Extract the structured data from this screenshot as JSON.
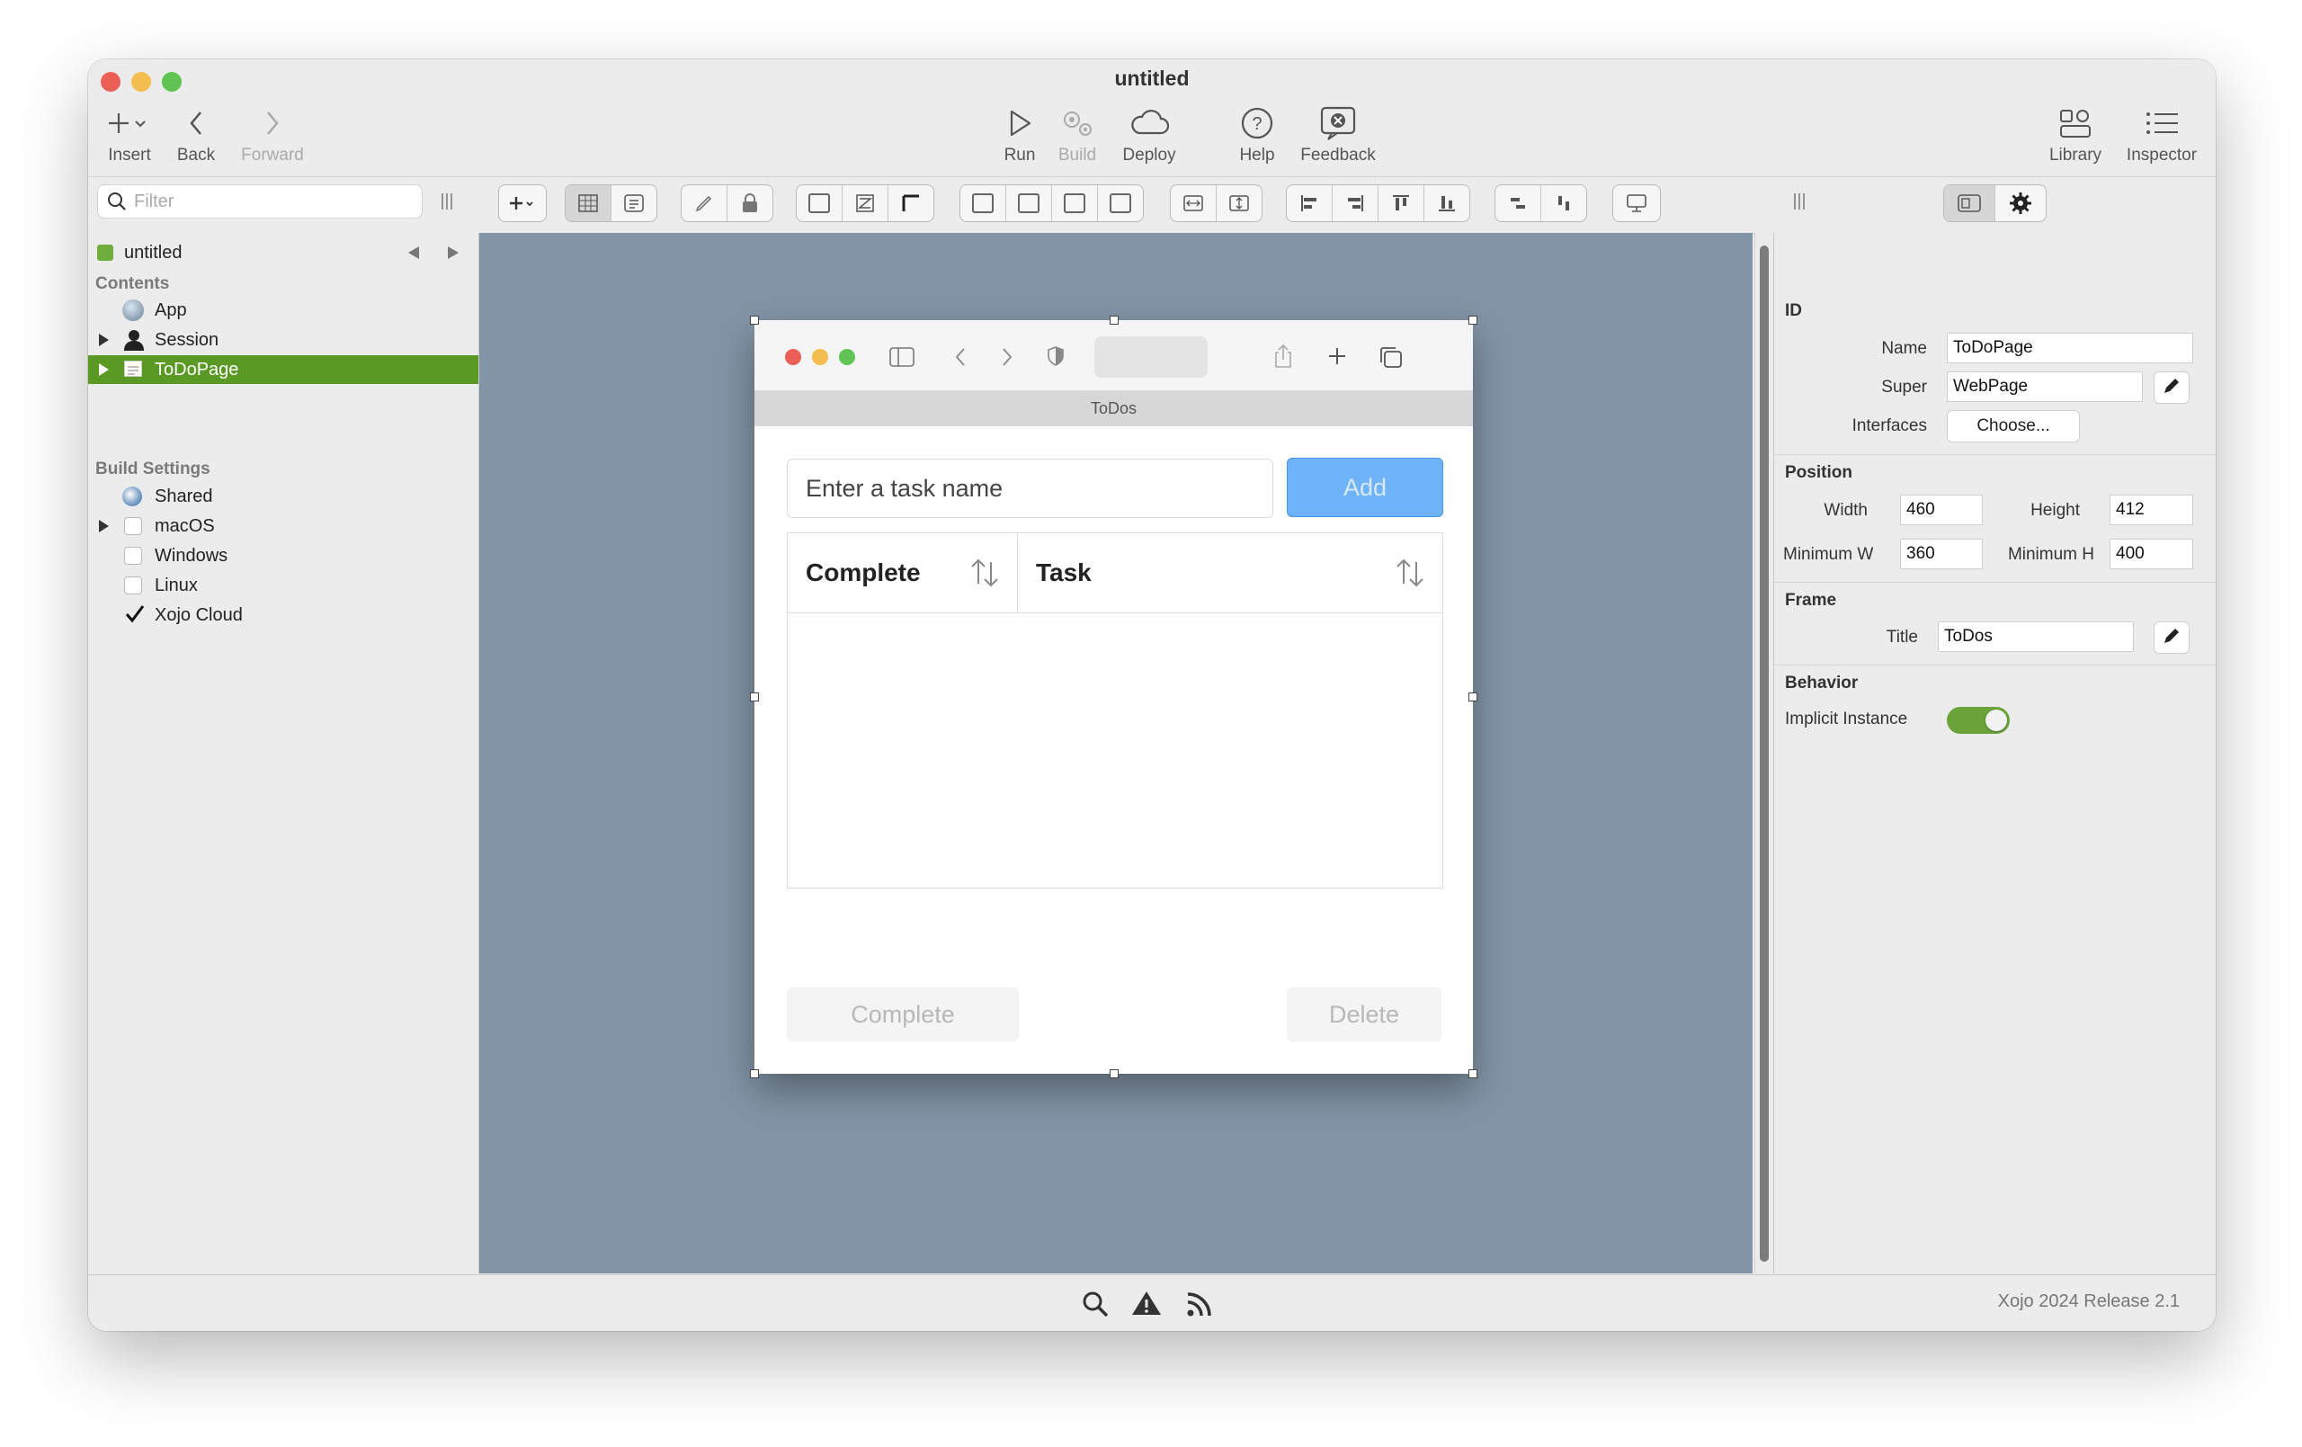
{
  "window": {
    "title": "untitled",
    "traffic_colors": [
      "#ec5f57",
      "#f3bd4f",
      "#5fc454"
    ]
  },
  "toolbar": {
    "insert_label": "Insert",
    "back_label": "Back",
    "forward_label": "Forward",
    "run_label": "Run",
    "build_label": "Build",
    "deploy_label": "Deploy",
    "help_label": "Help",
    "feedback_label": "Feedback",
    "library_label": "Library",
    "inspector_label": "Inspector"
  },
  "filter": {
    "placeholder": "Filter"
  },
  "navigator": {
    "project": "untitled",
    "contents_header": "Contents",
    "items": [
      {
        "label": "App",
        "icon": "app-icon"
      },
      {
        "label": "Session",
        "icon": "session-icon"
      },
      {
        "label": "ToDoPage",
        "icon": "webpage-icon",
        "selected": true
      }
    ],
    "build_header": "Build Settings",
    "build_items": [
      {
        "label": "Shared",
        "icon": "shared-icon"
      },
      {
        "label": "macOS",
        "checked": false
      },
      {
        "label": "Windows",
        "checked": false
      },
      {
        "label": "Linux",
        "checked": false
      },
      {
        "label": "Xojo Cloud",
        "checked": true
      }
    ],
    "selected_color": "#5a9a24"
  },
  "designer": {
    "tab_title": "ToDos",
    "task_placeholder": "Enter a task name",
    "add_label": "Add",
    "col_complete": "Complete",
    "col_task": "Task",
    "complete_btn": "Complete",
    "delete_btn": "Delete",
    "canvas_color": "#8294a6",
    "add_color": "#6eb3f7"
  },
  "inspector": {
    "id_header": "ID",
    "name_label": "Name",
    "name_value": "ToDoPage",
    "super_label": "Super",
    "super_value": "WebPage",
    "interfaces_label": "Interfaces",
    "interfaces_button": "Choose...",
    "position_header": "Position",
    "width_label": "Width",
    "width_value": "460",
    "height_label": "Height",
    "height_value": "412",
    "minw_label": "Minimum W",
    "minw_value": "360",
    "minh_label": "Minimum H",
    "minh_value": "400",
    "frame_header": "Frame",
    "title_label": "Title",
    "title_value": "ToDos",
    "behavior_header": "Behavior",
    "implicit_label": "Implicit Instance",
    "implicit_on": true
  },
  "status": {
    "version": "Xojo 2024 Release 2.1"
  }
}
